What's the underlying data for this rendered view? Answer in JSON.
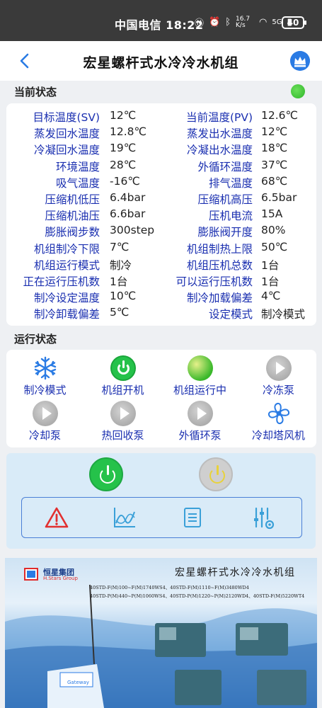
{
  "status_bar": {
    "carrier_time": "中国电信 18:22",
    "speed": "16.7 K/s",
    "network": "5G",
    "battery": "40"
  },
  "header": {
    "title": "宏星螺杆式水冷冷水机组"
  },
  "current": {
    "section_title": "当前状态",
    "rows": [
      {
        "l1": "目标温度(SV)",
        "v1": "12℃",
        "l2": "当前温度(PV)",
        "v2": "12.6℃"
      },
      {
        "l1": "蒸发回水温度",
        "v1": "12.8℃",
        "l2": "蒸发出水温度",
        "v2": "12℃"
      },
      {
        "l1": "冷凝回水温度",
        "v1": "19℃",
        "l2": "冷凝出水温度",
        "v2": "18℃"
      },
      {
        "l1": "环境温度",
        "v1": "28℃",
        "l2": "外循环温度",
        "v2": "37℃"
      },
      {
        "l1": "吸气温度",
        "v1": "-16℃",
        "l2": "排气温度",
        "v2": "68℃"
      },
      {
        "l1": "压缩机低压",
        "v1": "6.4bar",
        "l2": "压缩机高压",
        "v2": "6.5bar"
      },
      {
        "l1": "压缩机油压",
        "v1": "6.6bar",
        "l2": "压机电流",
        "v2": "15A"
      },
      {
        "l1": "膨胀阀步数",
        "v1": "300step",
        "l2": "膨胀阀开度",
        "v2": "80%"
      },
      {
        "l1": "机组制冷下限",
        "v1": "7℃",
        "l2": "机组制热上限",
        "v2": "50℃"
      },
      {
        "l1": "机组运行模式",
        "v1": "制冷",
        "l2": "机组压机总数",
        "v2": "1台"
      },
      {
        "l1": "正在运行压机数",
        "v1": "1台",
        "l2": "可以运行压机数",
        "v2": "1台"
      },
      {
        "l1": "制冷设定温度",
        "v1": "10℃",
        "l2": "制冷加载偏差",
        "v2": "4℃"
      },
      {
        "l1": "制冷卸载偏差",
        "v1": "5℃",
        "l2": "设定模式",
        "v2": "制冷模式"
      }
    ]
  },
  "running": {
    "section_title": "运行状态",
    "items": [
      {
        "label": "制冷模式",
        "icon": "snowflake-icon"
      },
      {
        "label": "机组开机",
        "icon": "power-icon"
      },
      {
        "label": "机组运行中",
        "icon": "status-ball-icon"
      },
      {
        "label": "冷冻泵",
        "icon": "play-icon"
      },
      {
        "label": "冷却泵",
        "icon": "play-icon"
      },
      {
        "label": "热回收泵",
        "icon": "play-icon"
      },
      {
        "label": "外循环泵",
        "icon": "play-icon"
      },
      {
        "label": "冷却塔风机",
        "icon": "fan-icon"
      }
    ]
  },
  "banner": {
    "company": "恒星集团",
    "company_en": "H.Stars Group",
    "title": "宏星螺杆式水冷冷水机组",
    "models_line1": "40STD-F(M)100~F(M)1740WS4、40STD-F(M)1110~F(M)3480WD4",
    "models_line2": "40STD-P(M)440~P(M)1060WS4、40STD-P(M)1220~P(M)2120WD4、40STD-F(M)5220WT4",
    "device_label": "Gateway"
  },
  "colors": {
    "accent": "#2a7be4",
    "label_blue": "#1a2fb0",
    "green": "#25c24a",
    "panel": "#d9ebf8"
  }
}
